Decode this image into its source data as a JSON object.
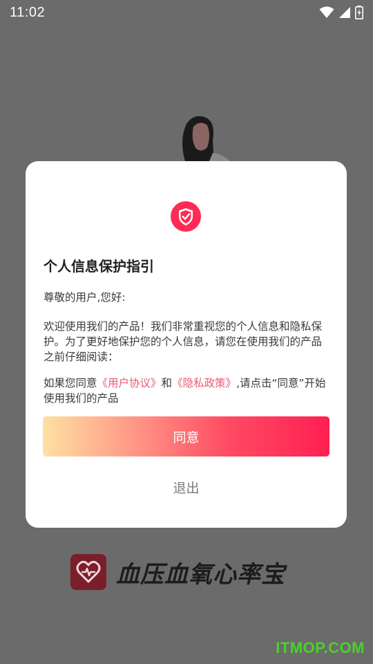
{
  "status_bar": {
    "time": "11:02",
    "icons": [
      "wifi-icon",
      "signal-icon",
      "battery-charging-icon"
    ]
  },
  "dialog": {
    "icon": "shield-check-icon",
    "title": "个人信息保护指引",
    "greeting": "尊敬的用户,您好:",
    "body": "欢迎使用我们的产品！我们非常重视您的个人信息和隐私保护。为了更好地保护您的个人信息，请您在使用我们的产品之前仔细阅读：",
    "consent_prefix": "如果您同意",
    "user_agreement_link": "《用户协议》",
    "consent_and": "和",
    "privacy_policy_link": "《隐私政策》",
    "consent_suffix": ",请点击“同意”开始使用我们的产品",
    "agree_button": "同意",
    "exit_button": "退出"
  },
  "app_logo": {
    "icon": "heart-pulse-icon",
    "name": "血压血氧心率宝"
  },
  "watermark": "ITMOP.COM",
  "colors": {
    "accent": "#ff2052",
    "link": "#e85a74",
    "overlay": "#6b6b6b",
    "gradient_start": "#fde1a3"
  }
}
